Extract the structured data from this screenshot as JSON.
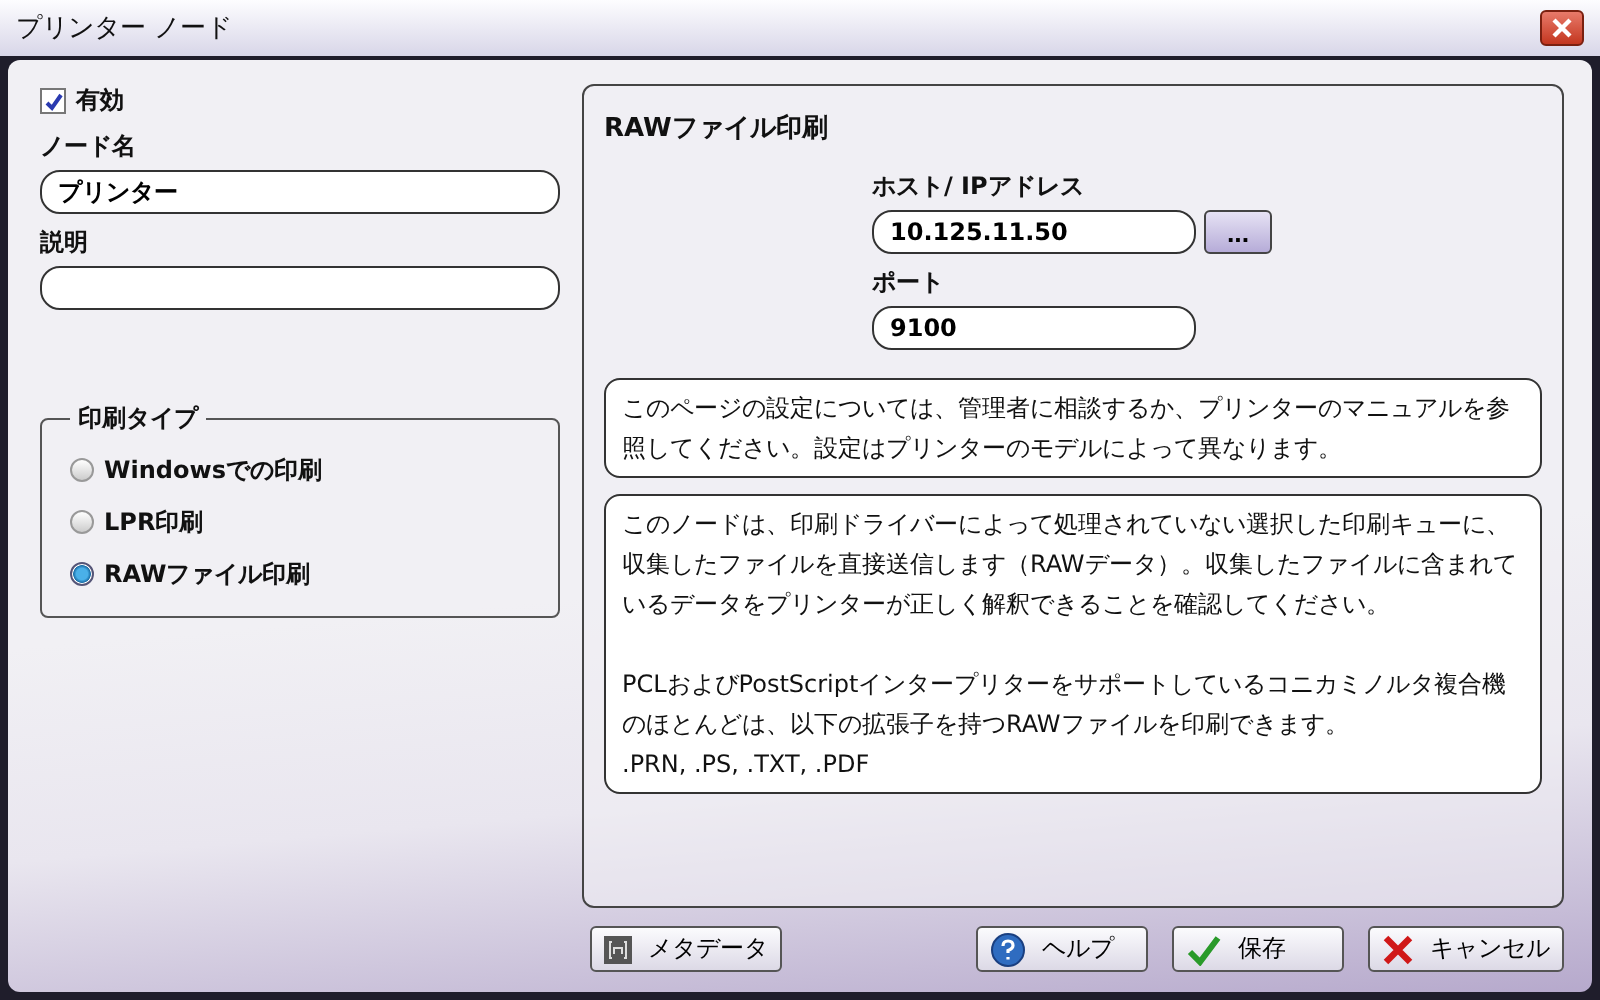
{
  "window": {
    "title": "プリンター ノード"
  },
  "enabled": {
    "label": "有効",
    "checked": true
  },
  "node_name": {
    "label": "ノード名",
    "value": "プリンター"
  },
  "description_field": {
    "label": "説明"
  },
  "print_type": {
    "legend": "印刷タイプ",
    "options": [
      {
        "label": "Windowsでの印刷",
        "selected": false
      },
      {
        "label": "LPR印刷",
        "selected": false
      },
      {
        "label": "RAWファイル印刷",
        "selected": true
      }
    ]
  },
  "panel": {
    "title": "RAWファイル印刷",
    "host_label": "ホスト/ IPアドレス",
    "host_value": "10.125.11.50",
    "browse_button": "...",
    "port_label": "ポート",
    "port_value": "9100",
    "note": "このページの設定については、管理者に相談するか、プリンターのマニュアルを参照してください。設定はプリンターのモデルによって異なります。",
    "info_paragraphs": [
      "このノードは、印刷ドライバーによって処理されていない選択した印刷キューに、収集したファイルを直接送信します（RAWデータ）。収集したファイルに含まれているデータをプリンターが正しく解釈できることを確認してください。",
      "PCLおよびPostScriptインタープリターをサポートしているコニカミノルタ複合機のほとんどは、以下の拡張子を持つRAWファイルを印刷できます。"
    ],
    "extensions": ".PRN, .PS, .TXT, .PDF"
  },
  "buttons": [
    {
      "kind": "metadata",
      "label": "メタデータ"
    },
    {
      "kind": "help",
      "label": "ヘルプ"
    },
    {
      "kind": "save",
      "label": "保存"
    },
    {
      "kind": "cancel",
      "label": "キャンセル"
    }
  ]
}
